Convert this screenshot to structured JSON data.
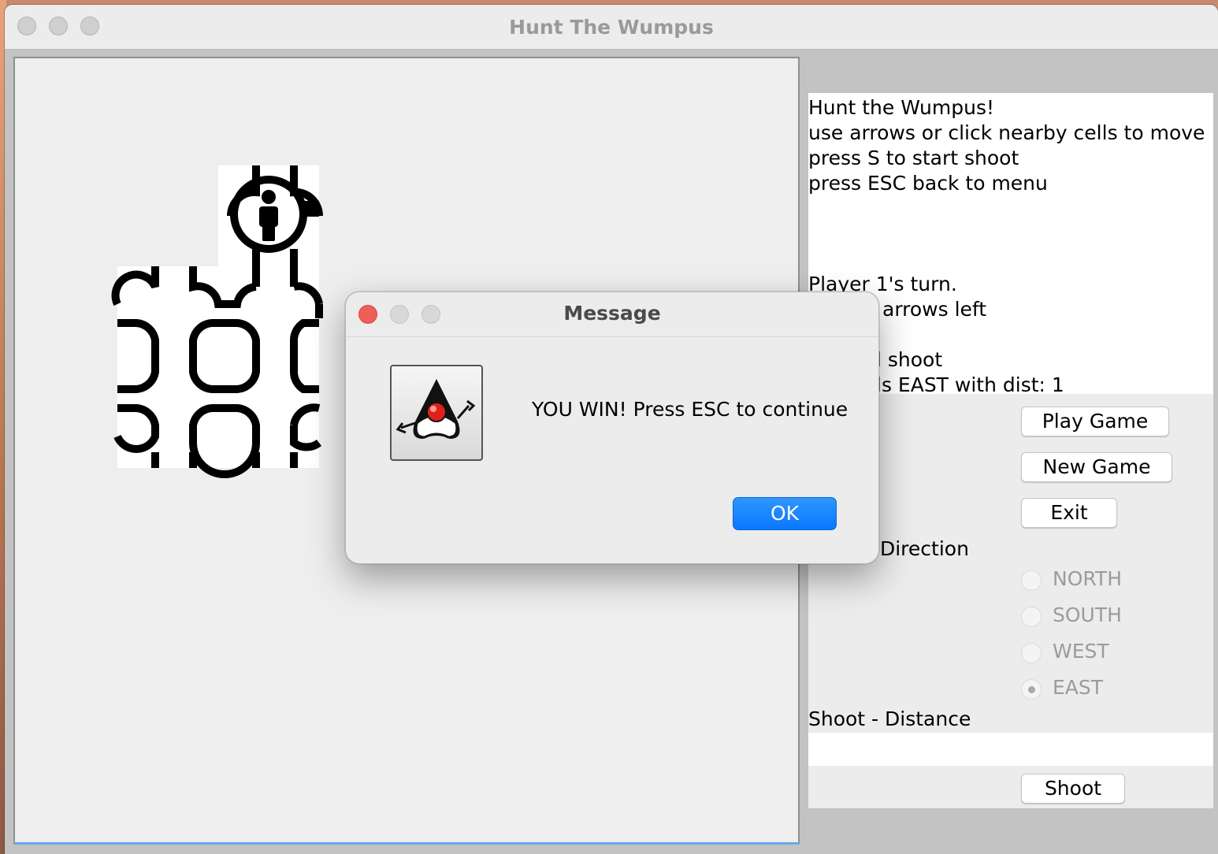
{
  "window": {
    "title": "Hunt The Wumpus"
  },
  "info": {
    "lines": [
      "Hunt the Wumpus!",
      "use arrows or click nearby cells to move",
      "press S to start shoot",
      "press ESC back to menu",
      "Player 1's turn.",
      "arrows left",
      "l shoot",
      "ls EAST with dist: 1"
    ]
  },
  "buttons": {
    "play_game": "Play Game",
    "new_game": "New Game",
    "exit": "Exit",
    "shoot": "Shoot"
  },
  "shoot_direction": {
    "label": "- Direction",
    "options": [
      "NORTH",
      "SOUTH",
      "WEST",
      "EAST"
    ],
    "selected": "EAST"
  },
  "shoot_distance": {
    "label": "Shoot - Distance",
    "value": ""
  },
  "dialog": {
    "title": "Message",
    "message": "YOU WIN! Press ESC to continue",
    "ok_label": "OK",
    "icon": "java-duke-icon"
  }
}
